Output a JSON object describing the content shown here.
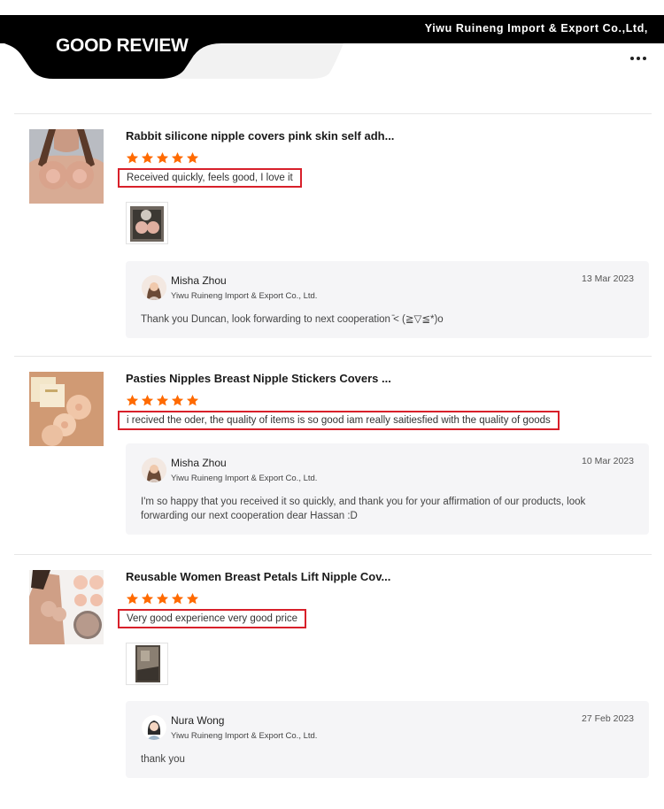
{
  "header": {
    "company": "Yiwu Ruineng Import & Export Co.,Ltd,",
    "tab_title": "GOOD REVIEW",
    "more_icon": "more-horizontal-icon"
  },
  "colors": {
    "header_bg": "#000000",
    "star": "#ff6a00",
    "highlight_border": "#d8202a",
    "reply_bg": "#f5f5f7"
  },
  "reviews": [
    {
      "product_title": "Rabbit silicone nipple covers pink skin self adh...",
      "rating": 5,
      "comment": "Received quickly, feels good, I love it",
      "has_photo": true,
      "reply": {
        "name": "Misha Zhou",
        "company": "Yiwu Ruineng Import & Export Co., Ltd.",
        "date": "13 Mar 2023",
        "text": "Thank you Duncan, look forwarding to next cooperation ̄< (≧▽≦*)o"
      }
    },
    {
      "product_title": "Pasties Nipples Breast Nipple Stickers Covers ...",
      "rating": 5,
      "comment": "i recived the oder, the quality of items is so good iam really saitiesfied with the quality of goods",
      "has_photo": false,
      "reply": {
        "name": "Misha Zhou",
        "company": "Yiwu Ruineng Import & Export Co., Ltd.",
        "date": "10 Mar 2023",
        "text": "I'm so happy that you received it so quickly, and thank you for your affirmation of our products, look forwarding our next cooperation dear Hassan  :D"
      }
    },
    {
      "product_title": "Reusable Women Breast Petals Lift Nipple Cov...",
      "rating": 5,
      "comment": "Very good experience very good price",
      "has_photo": true,
      "reply": {
        "name": "Nura Wong",
        "company": "Yiwu Ruineng Import & Export Co., Ltd.",
        "date": "27 Feb 2023",
        "text": "thank you"
      }
    }
  ]
}
